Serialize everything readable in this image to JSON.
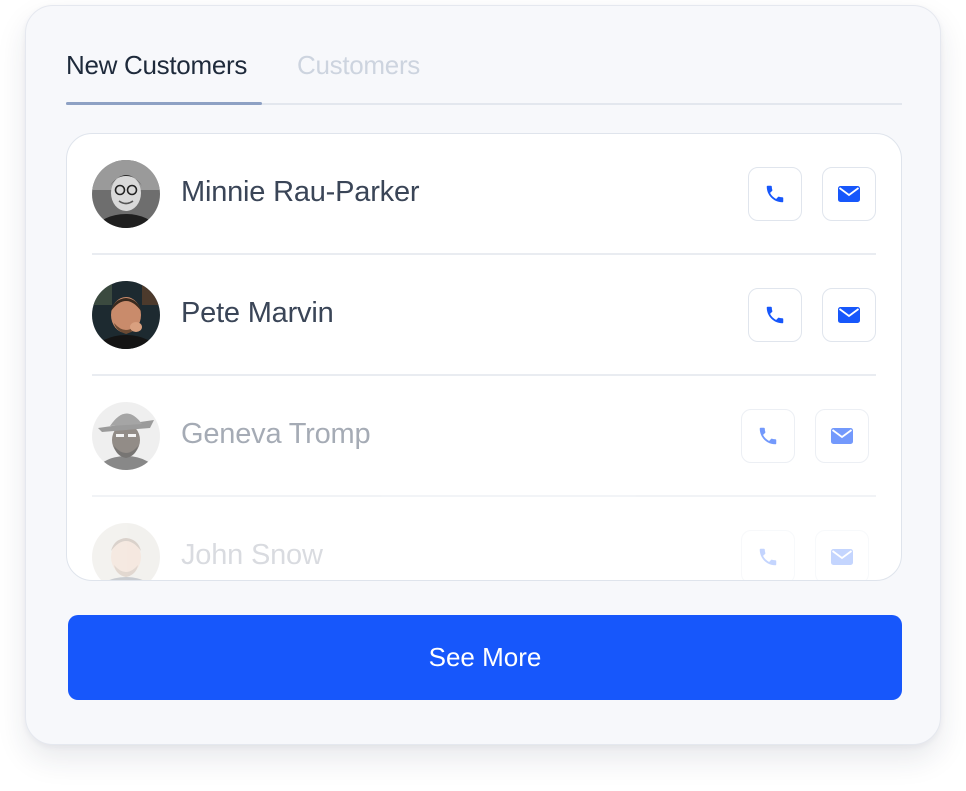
{
  "tabs": [
    {
      "label": "New Customers",
      "active": true
    },
    {
      "label": "Customers",
      "active": false
    }
  ],
  "customers": [
    {
      "name": "Minnie Rau-Parker",
      "avatar": "avatar-photo"
    },
    {
      "name": "Pete Marvin",
      "avatar": "avatar-photo"
    },
    {
      "name": "Geneva Tromp",
      "avatar": "avatar-photo"
    },
    {
      "name": "John Snow",
      "avatar": "avatar-photo"
    }
  ],
  "actions": {
    "call_icon": "phone-icon",
    "mail_icon": "envelope-icon"
  },
  "see_more_label": "See More",
  "colors": {
    "accent": "#1757fb",
    "icon": "#1757fb",
    "tab_active": "#1e2a3b",
    "tab_inactive": "#cdd4df",
    "card_bg": "#f7f8fb"
  }
}
